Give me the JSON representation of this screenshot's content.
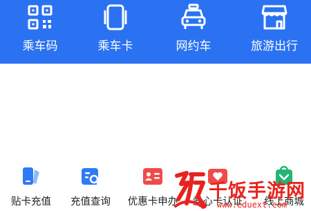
{
  "colors": {
    "header_bg": "#2a72f2",
    "icon_blue": "#2f7af5",
    "icon_red": "#ef4b4b",
    "icon_green": "#22b573",
    "watermark_red": "#e8231e"
  },
  "top_nav": {
    "items": [
      {
        "label": "乘车码",
        "icon": "qr-code-icon"
      },
      {
        "label": "乘车卡",
        "icon": "phone-card-icon"
      },
      {
        "label": "网约车",
        "icon": "taxi-icon"
      },
      {
        "label": "旅游出行",
        "icon": "shop-icon"
      }
    ]
  },
  "services": {
    "items": [
      {
        "label": "贴卡充值",
        "icon": "card-topup-icon"
      },
      {
        "label": "充值查询",
        "icon": "recharge-query-icon"
      },
      {
        "label": "优惠卡申办",
        "icon": "discount-card-icon"
      },
      {
        "label": "爱心卡认证",
        "icon": "love-card-icon"
      },
      {
        "label": "线上商城",
        "icon": "mall-icon"
      }
    ]
  },
  "watermark": {
    "text": "千饭手游网",
    "url": "www.eduext.com"
  }
}
